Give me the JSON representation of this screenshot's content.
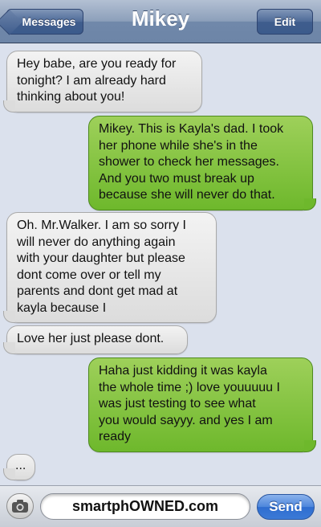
{
  "header": {
    "back_label": "Messages",
    "title": "Mikey",
    "edit_label": "Edit"
  },
  "messages": [
    {
      "sender": "contact",
      "text": "Hey babe, are you ready for\ntonight? I am already hard\nthinking about you!"
    },
    {
      "sender": "me",
      "text": "Mikey. This is Kayla's dad. I took\nher phone while she's in the\nshower to check her messages.\nAnd you two must break up\nbecause she will never do that."
    },
    {
      "sender": "contact",
      "text": "Oh. Mr.Walker. I am so sorry I\nwill never do anything again\nwith your daughter but please\ndont come over or tell my\nparents and dont get mad at\nkayla because I"
    },
    {
      "sender": "contact",
      "text": "Love her just please dont."
    },
    {
      "sender": "me",
      "text": "Haha just kidding it was kayla\nthe whole time ;) love youuuuu I\nwas just testing to see what\nyou would sayyy. and yes I am\nready"
    },
    {
      "sender": "contact",
      "text": "..."
    }
  ],
  "composer": {
    "watermark": "smartphOWNED.com",
    "send_label": "Send"
  },
  "colors": {
    "incoming_bubble": "#dcdcdc",
    "outgoing_bubble": "#7cc23a",
    "send_button": "#3b7ad6"
  }
}
